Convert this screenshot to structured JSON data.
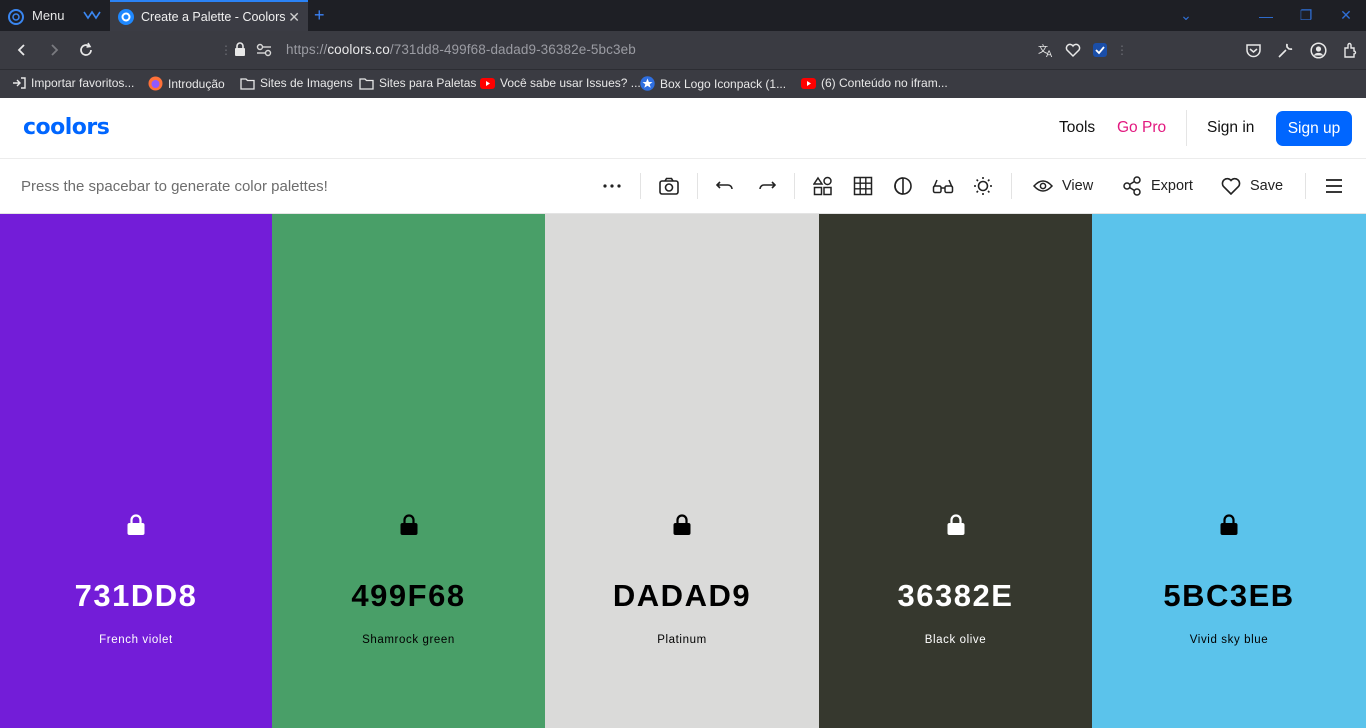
{
  "browser": {
    "menu_label": "Menu",
    "tab_title": "Create a Palette - Coolors",
    "url_prefix": "https://",
    "url_host": "coolors.co",
    "url_path": "/731dd8-499f68-dadad9-36382e-5bc3eb",
    "bookmarks": [
      {
        "label": "Importar favoritos...",
        "icon": "import-icon"
      },
      {
        "label": "Introdução",
        "icon": "firefox-icon"
      },
      {
        "label": "Sites de Imagens",
        "icon": "folder-icon"
      },
      {
        "label": "Sites para Paletas",
        "icon": "folder-icon"
      },
      {
        "label": "Você sabe usar Issues? ...",
        "icon": "youtube-icon"
      },
      {
        "label": "Box Logo Iconpack (1...",
        "icon": "star-icon"
      },
      {
        "label": "(6) Conteúdo no ifram...",
        "icon": "youtube-icon"
      }
    ]
  },
  "header": {
    "logo": "coolors",
    "tools": "Tools",
    "go_pro": "Go Pro",
    "sign_in": "Sign in",
    "sign_up": "Sign up"
  },
  "toolbar": {
    "hint": "Press the spacebar to generate color palettes!",
    "view": "View",
    "export": "Export",
    "save": "Save"
  },
  "colors": {
    "accent": "#0066ff",
    "go_pro": "#e2187f"
  },
  "palette": [
    {
      "hex": "731DD8",
      "name": "French violet",
      "color": "#731DD8",
      "text_color": "#ffffff"
    },
    {
      "hex": "499F68",
      "name": "Shamrock green",
      "color": "#499F68",
      "text_color": "#000000"
    },
    {
      "hex": "DADAD9",
      "name": "Platinum",
      "color": "#DADAD9",
      "text_color": "#000000"
    },
    {
      "hex": "36382E",
      "name": "Black olive",
      "color": "#36382E",
      "text_color": "#ffffff"
    },
    {
      "hex": "5BC3EB",
      "name": "Vivid sky blue",
      "color": "#5BC3EB",
      "text_color": "#000000"
    }
  ]
}
